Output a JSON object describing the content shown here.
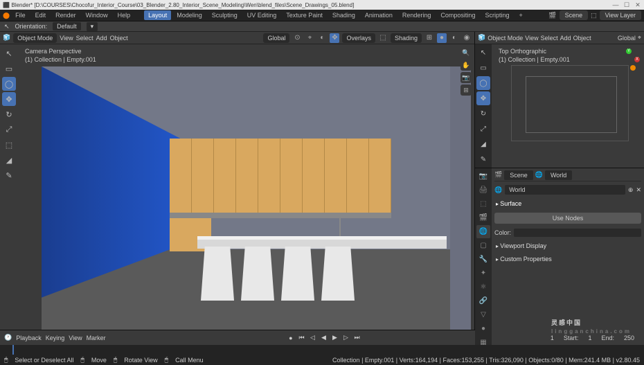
{
  "title": "Blender* [D:\\COURSES\\Chocofur_Interior_Course\\03_Blender_2.80_Interior_Scene_Modeling\\Wen\\blend_files\\Scene_Drawings_05.blend]",
  "menubar": {
    "items": [
      "File",
      "Edit",
      "Render",
      "Window",
      "Help"
    ],
    "tabs": [
      "Layout",
      "Modeling",
      "Sculpting",
      "UV Editing",
      "Texture Paint",
      "Shading",
      "Animation",
      "Rendering",
      "Compositing",
      "Scripting"
    ],
    "scene": "Scene",
    "viewlayer": "View Layer"
  },
  "headerbar": {
    "orient": "Orientation:",
    "def": "Default"
  },
  "viewport": {
    "mode": "Object Mode",
    "menus": [
      "View",
      "Select",
      "Add",
      "Object"
    ],
    "pivot": "Global",
    "overlays": "Overlays",
    "shading": "Shading",
    "overlay": {
      "l1": "Camera Perspective",
      "l2": "(1) Collection | Empty.001"
    },
    "tools": [
      "↖",
      "▭",
      "◯",
      "✥",
      "↻",
      "⤢",
      "⬚",
      "◢",
      "✎"
    ]
  },
  "miniview": {
    "mode": "Object Mode",
    "menus": [
      "View",
      "Select",
      "Add",
      "Object"
    ],
    "pivot": "Global",
    "overlay": {
      "l1": "Top Orthographic",
      "l2": "(1) Collection | Empty.001"
    }
  },
  "properties": {
    "crumbs": [
      "Scene",
      "World"
    ],
    "world": "World",
    "surface": "Surface",
    "usenodes": "Use Nodes",
    "color": "Color:",
    "viewport_display": "Viewport Display",
    "custom_props": "Custom Properties"
  },
  "timeline": {
    "menus": [
      "Playback",
      "Keying",
      "View",
      "Marker"
    ],
    "cur": "1",
    "start_lbl": "Start:",
    "start": "1",
    "end_lbl": "End:",
    "end": "250"
  },
  "status": {
    "left": "Select or Deselect All",
    "mid1": "Move",
    "mid2": "Rotate View",
    "mid3": "Call Menu",
    "right": "Collection | Empty.001 | Verts:164,194 | Faces:153,255 | Tris:326,090 | Objects:0/80 | Mem:241.4 MB | v2.80.45"
  },
  "watermark": {
    "main": "灵感中国",
    "sub": "lingganchina.com"
  }
}
